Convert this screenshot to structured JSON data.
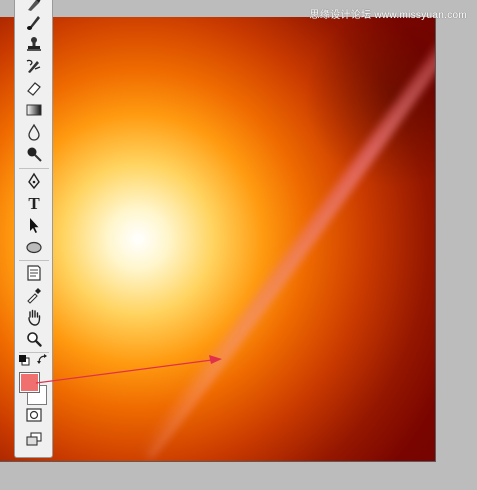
{
  "watermark": "思缘设计论坛 www.missyuan.com",
  "colors": {
    "foreground": "#f07070",
    "background": "#ffffff",
    "arrow": "#e0304a"
  },
  "toolbox": {
    "tools": [
      "history-brush-icon",
      "brush-icon",
      "clone-stamp-icon",
      "history-brush-alt-icon",
      "eraser-icon",
      "gradient-icon",
      "blur-icon",
      "dodge-icon",
      "pen-icon",
      "type-icon",
      "path-selection-icon",
      "ellipse-shape-icon",
      "notes-icon",
      "eyedropper-icon",
      "hand-icon",
      "zoom-icon",
      "default-colors-icon",
      "swap-colors-icon",
      "quick-mask-icon",
      "screen-mode-icon"
    ]
  }
}
